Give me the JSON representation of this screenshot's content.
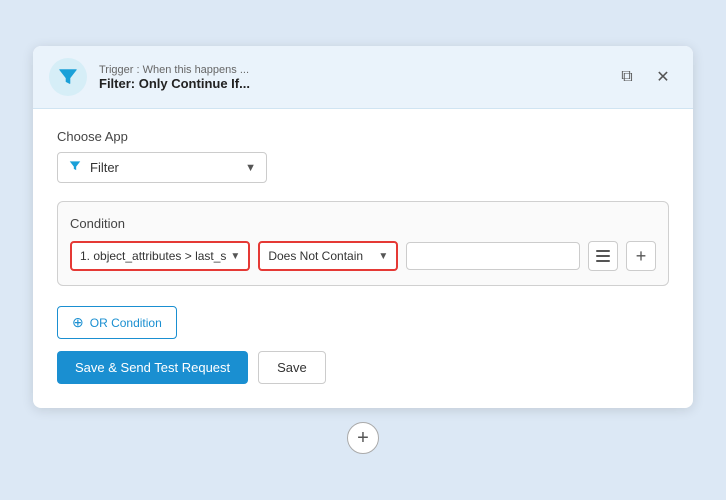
{
  "header": {
    "trigger_line": "Trigger : When this happens ...",
    "filter_line": "Filter: Only Continue If...",
    "copy_icon": "⧉",
    "close_icon": "✕"
  },
  "choose_app": {
    "label": "Choose App",
    "dropdown": {
      "value": "Filter",
      "chevron": "▼"
    }
  },
  "condition": {
    "label": "Condition",
    "field": {
      "value": "1. object_attributes > last_s",
      "chevron": "▼"
    },
    "operator": {
      "value": "Does Not Contain",
      "chevron": "▼"
    },
    "value_placeholder": ""
  },
  "buttons": {
    "or_condition": "OR Condition",
    "save_and_send": "Save & Send Test Request",
    "save": "Save"
  },
  "bottom_plus": "+"
}
